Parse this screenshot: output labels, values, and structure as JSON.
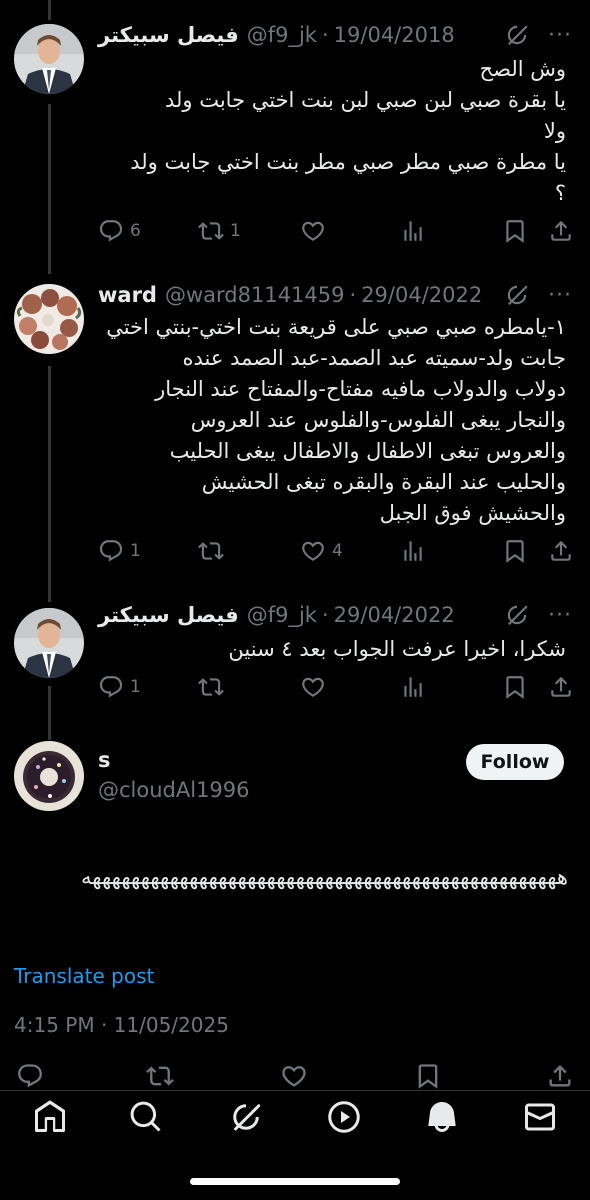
{
  "tweets": [
    {
      "name": "فيصل سبيكتر",
      "handle": "@f9_jk",
      "date": "19/04/2018",
      "text": "وش الصح\nيا بقرة صبي لبن صبي لبن بنت اختي جابت ولد\nولا\nيا مطرة صبي مطر صبي مطر بنت اختي جابت ولد\n؟",
      "replies": "6",
      "retweets": "1",
      "likes": ""
    },
    {
      "name": "ward",
      "handle": "@ward81141459",
      "date": "29/04/2022",
      "text": "١-يامطره صبي صبي على قريعة بنت اختي-بنتي اختي\nجابت ولد-سميته عبد الصمد-عبد الصمد عنده\nدولاب والدولاب مافيه مفتاح-والمفتاح عند النجار\nوالنجار يبغى الفلوس-والفلوس عند العروس\nوالعروس تبغى الاطفال والاطفال يبغى الحليب\nوالحليب عند البقرة والبقره تبغى الحشيش\nوالحشيش فوق الجبل",
      "replies": "1",
      "retweets": "",
      "likes": "4"
    },
    {
      "name": "فيصل سبيكتر",
      "handle": "@f9_jk",
      "date": "29/04/2022",
      "text": "شكرا، اخيرا عرفت الجواب بعد ٤ سنين",
      "replies": "1",
      "retweets": "",
      "likes": ""
    }
  ],
  "main_post": {
    "name": "s",
    "handle": "@cloudAl1996",
    "follow_label": "Follow",
    "text": "هههههههههههههههههههههههههههههههههههههههههههههههههه",
    "translate_label": "Translate post",
    "timestamp": "4:15 PM · 11/05/2025"
  },
  "separator": "·",
  "icons": {
    "reply": "reply-icon",
    "retweet": "retweet-icon",
    "like": "heart-icon",
    "views": "views-icon",
    "bookmark": "bookmark-icon",
    "share": "share-icon",
    "grok": "grok-icon",
    "more": "more-icon"
  },
  "nav": [
    "home-icon",
    "search-icon",
    "grok-icon",
    "video-icon",
    "notifications-icon",
    "messages-icon"
  ],
  "colors": {
    "background": "#000000",
    "text": "#e7e9ea",
    "muted": "#71767b",
    "link": "#1d9bf0",
    "follow_bg": "#eff3f4"
  }
}
